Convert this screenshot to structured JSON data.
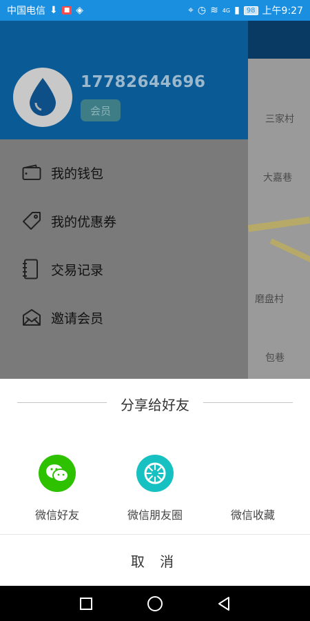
{
  "status_bar": {
    "carrier": "中国电信",
    "battery": "98",
    "time": "上午9:27",
    "network": "4G"
  },
  "map": {
    "labels": [
      "三家村",
      "大嘉巷",
      "磨盘村",
      "包巷"
    ]
  },
  "drawer": {
    "phone": "17782644696",
    "member_badge": "会员",
    "menu": [
      {
        "label": "我的钱包",
        "icon": "wallet-icon"
      },
      {
        "label": "我的优惠券",
        "icon": "coupon-tag-icon"
      },
      {
        "label": "交易记录",
        "icon": "notebook-icon"
      },
      {
        "label": "邀请会员",
        "icon": "invite-envelope-icon"
      }
    ]
  },
  "share_sheet": {
    "title": "分享给好友",
    "options": [
      {
        "label": "微信好友",
        "icon": "wechat-icon",
        "color": "#2dc100"
      },
      {
        "label": "微信朋友圈",
        "icon": "moments-icon",
        "color": "#17c1c1"
      },
      {
        "label": "微信收藏",
        "icon": "favorites-icon",
        "color": ""
      }
    ],
    "cancel_label": "取 消"
  },
  "nav_bar": {
    "buttons": [
      "recent-apps-icon",
      "home-icon",
      "back-icon"
    ]
  }
}
